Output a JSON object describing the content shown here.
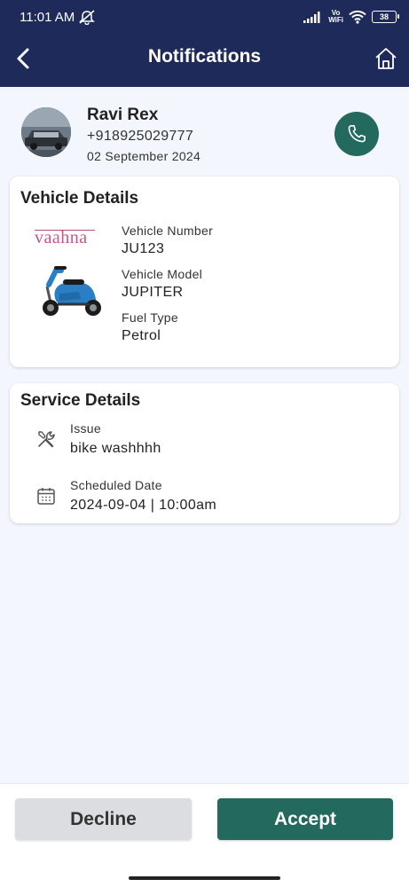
{
  "status_bar": {
    "time": "11:01 AM",
    "volte_top": "Vo",
    "volte_bottom": "WiFi",
    "battery": "38",
    "icons": [
      "mute-icon",
      "signal-icon",
      "wifi-icon",
      "battery-icon"
    ]
  },
  "header": {
    "title": "Notifications",
    "back_icon": "chevron-left-icon",
    "home_icon": "home-icon",
    "color": "#1e2a5a"
  },
  "customer": {
    "name": "Ravi Rex",
    "phone": "+918925029777",
    "date": "02 September 2024",
    "call_icon": "phone-icon"
  },
  "vehicle_details": {
    "title": "Vehicle Details",
    "brand": "vaahna",
    "number_label": "Vehicle Number",
    "number_value": "JU123",
    "model_label": "Vehicle Model",
    "model_value": "JUPITER",
    "fuel_label": "Fuel Type",
    "fuel_value": "Petrol"
  },
  "service_details": {
    "title": "Service Details",
    "issue_label": "Issue",
    "issue_value": "bike washhhh",
    "schedule_label": "Scheduled Date",
    "schedule_value": "2024-09-04 | 10:00am"
  },
  "actions": {
    "decline_label": "Decline",
    "accept_label": "Accept",
    "accent_color": "#23695d"
  }
}
